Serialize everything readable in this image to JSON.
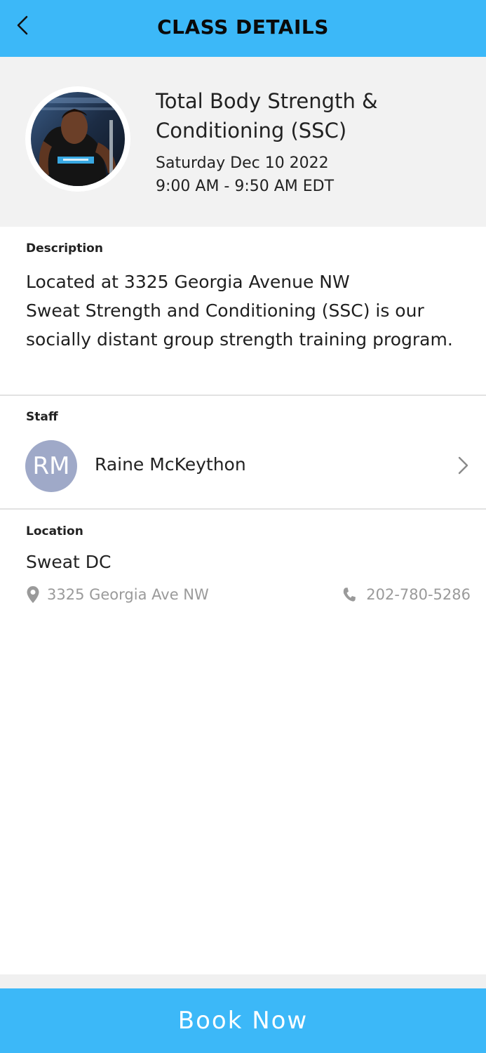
{
  "header": {
    "title": "CLASS DETAILS",
    "accent_color": "#3cb8f8",
    "back_icon": "chevron-left-icon"
  },
  "class_info": {
    "title": "Total Body Strength & Conditioning (SSC)",
    "date": "Saturday Dec 10 2022",
    "time": "9:00 AM - 9:50 AM EDT",
    "image": "class-photo"
  },
  "description": {
    "label": "Description",
    "text": "Located at 3325 Georgia Avenue NW\nSweat Strength and Conditioning (SSC) is our socially distant group strength training program."
  },
  "staff": {
    "label": "Staff",
    "initials": "RM",
    "name": "Raine McKeython",
    "avatar_color": "#9fa9c8"
  },
  "location": {
    "label": "Location",
    "name": "Sweat DC",
    "address": "3325 Georgia Ave NW",
    "phone": "202-780-5286"
  },
  "footer": {
    "book_label": "Book Now"
  }
}
